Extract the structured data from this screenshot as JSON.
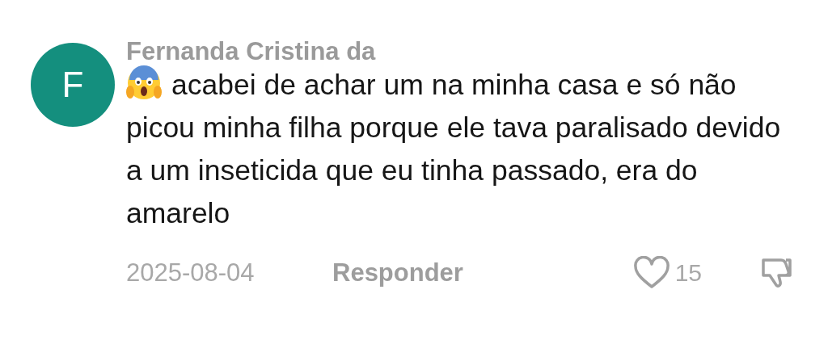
{
  "comment": {
    "avatar_letter": "F",
    "author": "Fernanda Cristina da",
    "text": "acabei de achar um na minha casa e só não picou minha filha porque ele tava paralisado devido a um inseticida que eu tinha passado, era do amarelo",
    "date": "2025-08-04",
    "reply_label": "Responder",
    "likes": "15"
  }
}
